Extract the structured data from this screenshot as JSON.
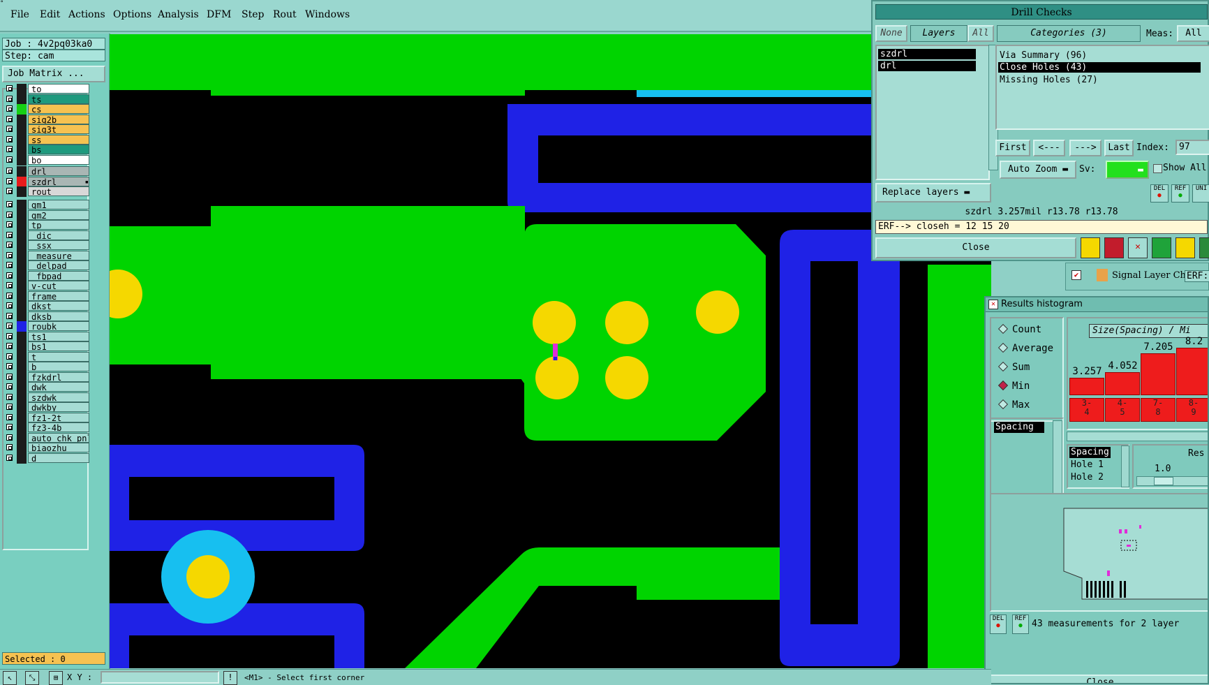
{
  "menu": [
    "File",
    "Edit",
    "Actions",
    "Options",
    "Analysis",
    "DFM",
    "Step",
    "Rout",
    "Windows"
  ],
  "job": {
    "label": "Job : 4v2pq03ka0",
    "step": "Step: cam",
    "matrix_button": "Job Matrix ..."
  },
  "layers_group1": [
    {
      "name": "to",
      "swatch": "#1c1c1c",
      "bg": "#ffffff"
    },
    {
      "name": "ts",
      "swatch": "#1c1c1c",
      "bg": "#1f9a7e"
    },
    {
      "name": "cs",
      "swatch": "#17d114",
      "bg": "#f6c251"
    },
    {
      "name": "sig2b",
      "swatch": "#1c1c1c",
      "bg": "#f6c251"
    },
    {
      "name": "sig3t",
      "swatch": "#1c1c1c",
      "bg": "#f6c251"
    },
    {
      "name": "ss",
      "swatch": "#1c1c1c",
      "bg": "#f6c251"
    },
    {
      "name": "bs",
      "swatch": "#1c1c1c",
      "bg": "#1f9a7e"
    },
    {
      "name": "bo",
      "swatch": "#1c1c1c",
      "bg": "#ffffff"
    }
  ],
  "layers_group2": [
    {
      "name": "drl",
      "swatch": "#1c1c1c",
      "bg": "#a9b6b4"
    },
    {
      "name": "szdrl",
      "swatch": "#e81c1c",
      "bg": "#a9b6b4"
    },
    {
      "name": "rout",
      "swatch": "#1c1c1c",
      "bg": "#d8d8d8"
    }
  ],
  "layers_group3": [
    "gm1",
    "gm2",
    "tp",
    "_dic",
    "_ssx",
    "_measure",
    "_delpad",
    "_fbpad",
    "v-cut",
    "frame",
    "dkst",
    "dksb",
    "roubk",
    "ts1",
    "bs1",
    "t",
    "b",
    "fzkdrl",
    "dwk",
    "szdwk",
    "dwkby",
    "fz1-2t",
    "fz3-4b",
    "auto_chk_pnl",
    "biaozhu",
    "d"
  ],
  "selected": "Selected : 0",
  "status": {
    "xy_label": "X Y :",
    "xy_value": "",
    "prompt": "<M1> - Select first corner"
  },
  "drill": {
    "title": "Drill Checks",
    "none": "None",
    "layers": "Layers",
    "all": "All",
    "layer_list": [
      "szdrl",
      "drl"
    ],
    "categories": "Categories (3)",
    "meas_label": "Meas:",
    "meas_value": "All",
    "category_items": [
      "Via Summary (96)",
      "Close Holes (43)",
      "Missing Holes (27)"
    ],
    "nav": [
      "First",
      "<---",
      "--->",
      "Last"
    ],
    "index_label": "Index:",
    "index_value": "97",
    "auto_zoom": "Auto Zoom",
    "sv_label": "Sv:",
    "show_all": "Show All",
    "replace_layers": "Replace layers",
    "info_line": "szdrl 3.257mil  r13.78  r13.78",
    "erf_line": "ERF--> closeh = 12 15 20",
    "close": "Close",
    "del": "DEL",
    "ref": "REF",
    "uni": "UNI"
  },
  "signal_window": {
    "label": "Signal Layer Ch",
    "erf": "ERF:"
  },
  "hist": {
    "title": "Results histogram",
    "radios": [
      "Count",
      "Average",
      "Sum",
      "Min",
      "Max"
    ],
    "selected_radio": "Min",
    "axis_title": "Size(Spacing) / Mi",
    "list_label": "Spacing",
    "bars": [
      {
        "value": "3.257",
        "range": "3-\n4",
        "height": 0.23
      },
      {
        "value": "4.052",
        "range": "4-\n5",
        "height": 0.3
      },
      {
        "value": "7.205",
        "range": "7-\n8",
        "height": 0.55
      },
      {
        "value": "8.2",
        "range": "8-\n9",
        "height": 0.62
      }
    ],
    "detail_lines": [
      "Spacing",
      "Hole 1",
      "Hole 2"
    ],
    "res_label": "Res",
    "res_value": "1.0",
    "measurements": "43 measurements for 2 layer",
    "close": "Close",
    "del": "DEL",
    "ref": "REF"
  },
  "colors": {
    "copper": "#00d400",
    "trace": "#1f22e6",
    "pad": "#f5d800",
    "hole_ring": "#17bff0",
    "background": "#000000",
    "mark": "#e02cd9"
  }
}
